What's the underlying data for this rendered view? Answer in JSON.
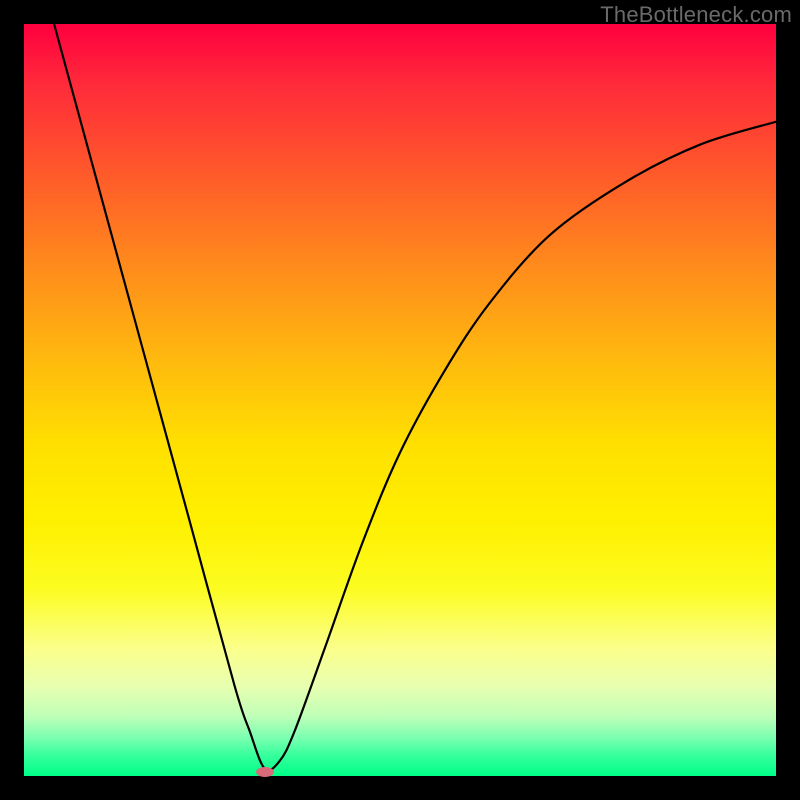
{
  "watermark": "TheBottleneck.com",
  "chart_data": {
    "type": "line",
    "title": "",
    "xlabel": "",
    "ylabel": "",
    "xlim": [
      0,
      1
    ],
    "ylim": [
      0,
      1
    ],
    "background": "rainbow-gradient (red top to green bottom)",
    "series": [
      {
        "name": "curve",
        "x": [
          0.04,
          0.1,
          0.16,
          0.22,
          0.28,
          0.3,
          0.32,
          0.34,
          0.36,
          0.4,
          0.45,
          0.5,
          0.56,
          0.62,
          0.7,
          0.8,
          0.9,
          1.0
        ],
        "y": [
          1.0,
          0.78,
          0.56,
          0.34,
          0.12,
          0.06,
          0.01,
          0.02,
          0.06,
          0.17,
          0.31,
          0.43,
          0.54,
          0.63,
          0.72,
          0.79,
          0.84,
          0.87
        ]
      }
    ],
    "marker": {
      "x": 0.32,
      "y": 0.005
    }
  }
}
